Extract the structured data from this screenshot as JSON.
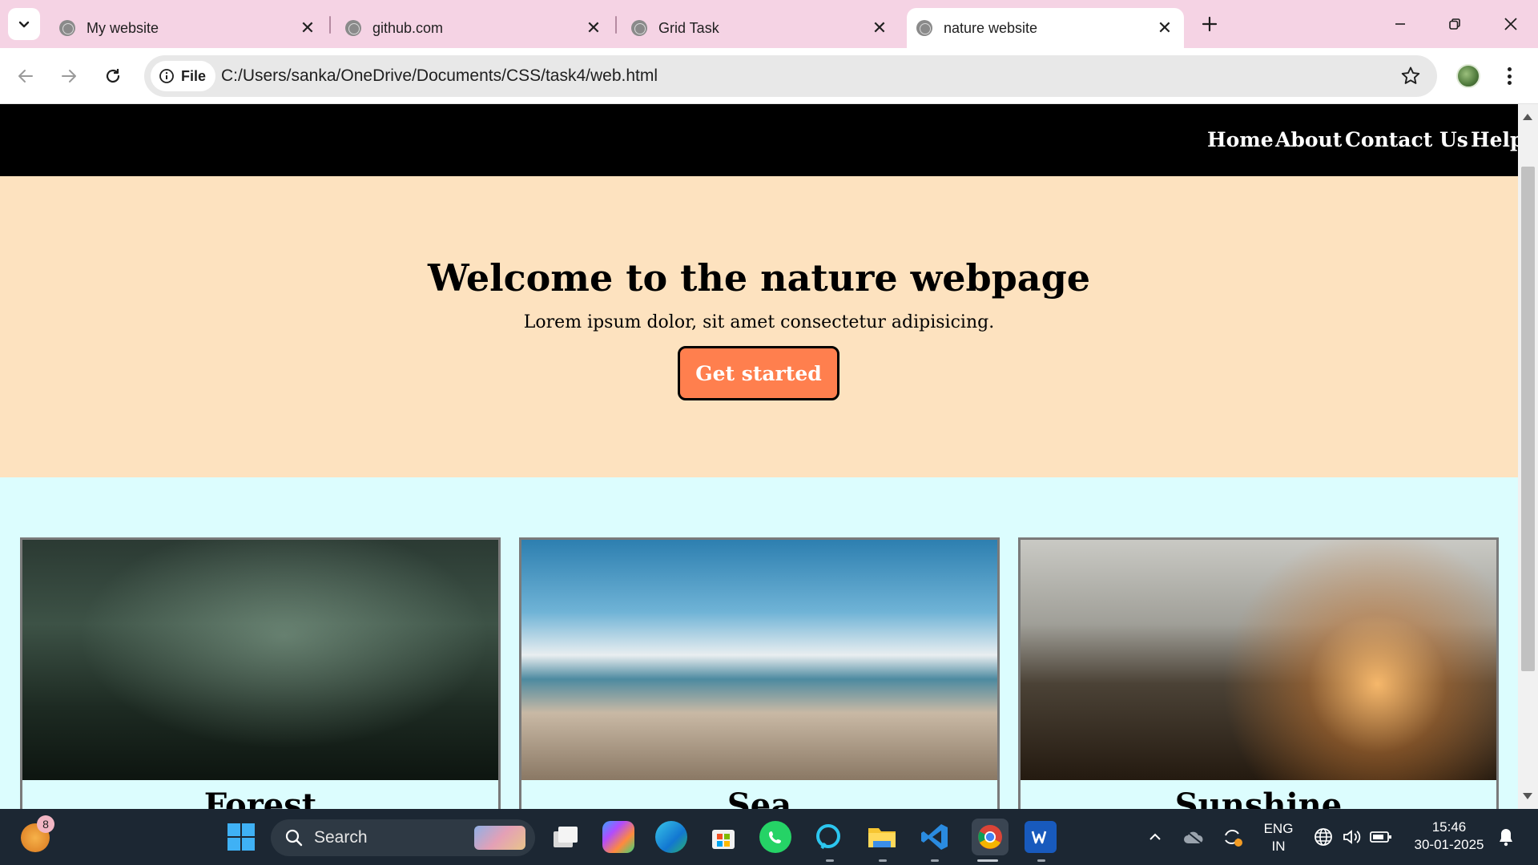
{
  "browser": {
    "tabs": [
      {
        "title": "My website",
        "active": false
      },
      {
        "title": "github.com",
        "active": false
      },
      {
        "title": "Grid Task",
        "active": false
      },
      {
        "title": "nature website",
        "active": true
      }
    ],
    "new_tab_icon": "plus-icon",
    "window_controls": [
      "minimize-icon",
      "restore-icon",
      "close-icon"
    ],
    "toolbar": {
      "chip_label": "File",
      "url": "C:/Users/sanka/OneDrive/Documents/CSS/task4/web.html"
    }
  },
  "page": {
    "nav": [
      "Home",
      "About",
      "Contact Us",
      "Help"
    ],
    "hero": {
      "title": "Welcome to the nature webpage",
      "subtitle": "Lorem ipsum dolor, sit amet consectetur adipisicing.",
      "cta": "Get started"
    },
    "cards": [
      "Forest",
      "Sea",
      "Sunshine"
    ]
  },
  "taskbar": {
    "widget_badge": "8",
    "search_placeholder": "Search",
    "language": "ENG",
    "region": "IN",
    "time": "15:46",
    "date": "30-01-2025"
  },
  "colors": {
    "tabstrip": "#f5d3e4",
    "nav": "#000000",
    "hero_bg": "#fde2bf",
    "cta_bg": "#ff7f4e",
    "cards_bg": "#dcfdfe",
    "taskbar": "#1c2733"
  }
}
